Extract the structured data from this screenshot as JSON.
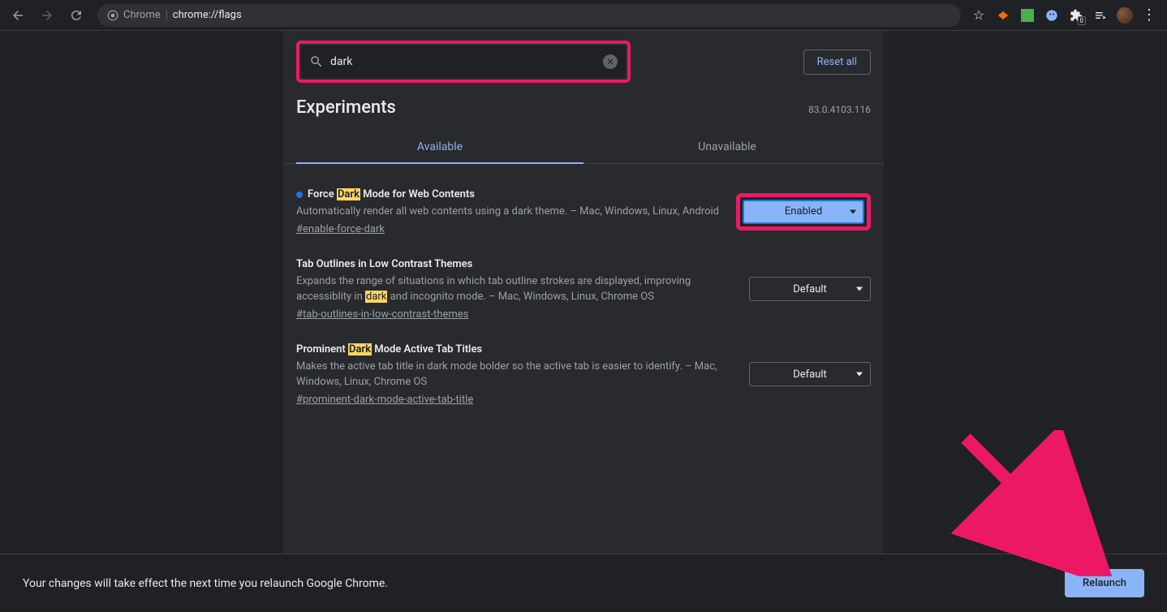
{
  "toolbar": {
    "address_host": "Chrome",
    "address_path": "chrome://flags"
  },
  "header": {
    "search_value": "dark",
    "reset_label": "Reset all"
  },
  "title": "Experiments",
  "version": "83.0.4103.116",
  "tabs": {
    "available": "Available",
    "unavailable": "Unavailable"
  },
  "flags": [
    {
      "title_pre": "Force ",
      "title_mark": "Dark",
      "title_post": " Mode for Web Contents",
      "has_dot": true,
      "desc": "Automatically render all web contents using a dark theme. – Mac, Windows, Linux, Android",
      "hash": "#enable-force-dark",
      "selected": "Enabled",
      "highlighted": true
    },
    {
      "title_pre": "Tab Outlines in Low Contrast Themes",
      "title_mark": "",
      "title_post": "",
      "has_dot": false,
      "desc_pre": "Expands the range of situations in which tab outline strokes are displayed, improving accessiblity in ",
      "desc_mark": "dark",
      "desc_post": " and incognito mode. – Mac, Windows, Linux, Chrome OS",
      "hash": "#tab-outlines-in-low-contrast-themes",
      "selected": "Default",
      "highlighted": false
    },
    {
      "title_pre": "Prominent ",
      "title_mark": "Dark",
      "title_post": " Mode Active Tab Titles",
      "has_dot": false,
      "desc": "Makes the active tab title in dark mode bolder so the active tab is easier to identify. – Mac, Windows, Linux, Chrome OS",
      "hash": "#prominent-dark-mode-active-tab-title",
      "selected": "Default",
      "highlighted": false
    }
  ],
  "bottom": {
    "message": "Your changes will take effect the next time you relaunch Google Chrome.",
    "relaunch_label": "Relaunch"
  }
}
